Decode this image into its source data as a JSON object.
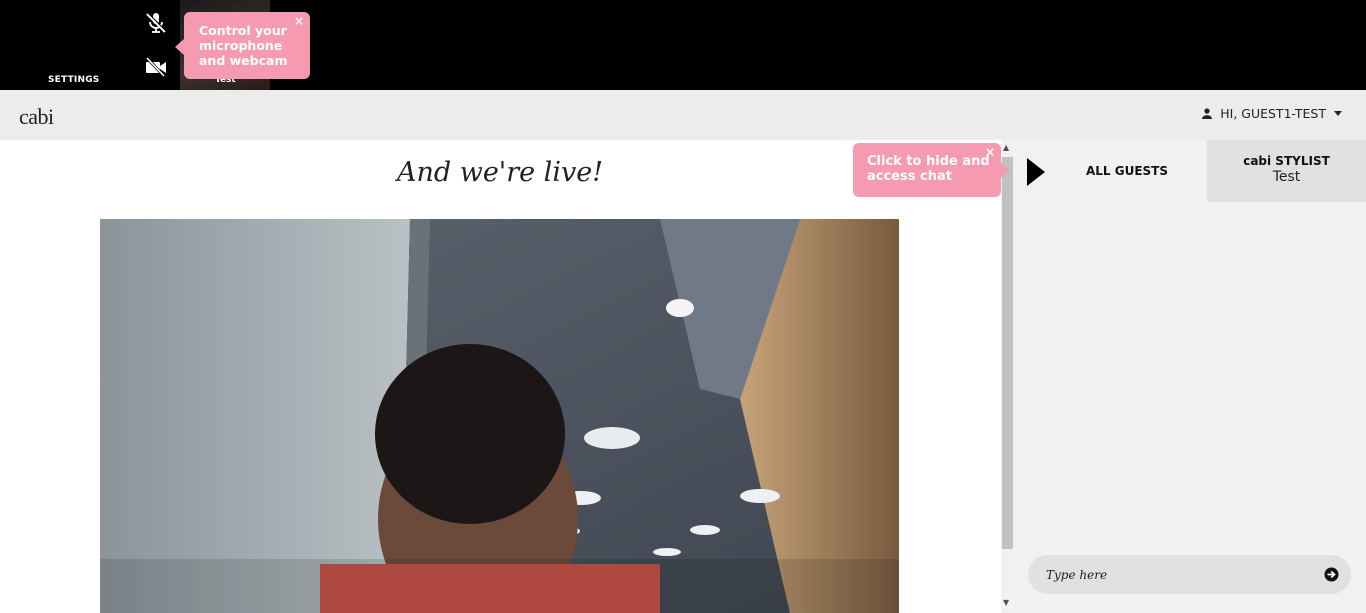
{
  "topbar": {
    "settings_label": "SETTINGS",
    "thumbnail_label": "Test",
    "mic_icon": "microphone-muted-icon",
    "cam_icon": "webcam-off-icon",
    "tooltip": {
      "text": "Control your microphone and webcam",
      "close": "×"
    }
  },
  "header": {
    "logo": "cabi",
    "user_greeting": "HI, GUEST1-TEST",
    "user_icon": "user-icon",
    "dropdown_icon": "caret-down-icon"
  },
  "main": {
    "title": "And we're live!"
  },
  "chat": {
    "tooltip": {
      "text": "Click to hide and access chat",
      "close": "×"
    },
    "toggle_icon": "play-arrow-icon",
    "tabs": [
      {
        "label": "ALL GUESTS"
      },
      {
        "label": "cabi STYLIST",
        "sub": "Test"
      }
    ],
    "input_placeholder": "Type here",
    "send_icon": "arrow-circle-right-icon"
  },
  "colors": {
    "tooltip_pink": "#f59ab0",
    "header_bg": "#ececec",
    "panel_bg": "#f1f1f1"
  }
}
